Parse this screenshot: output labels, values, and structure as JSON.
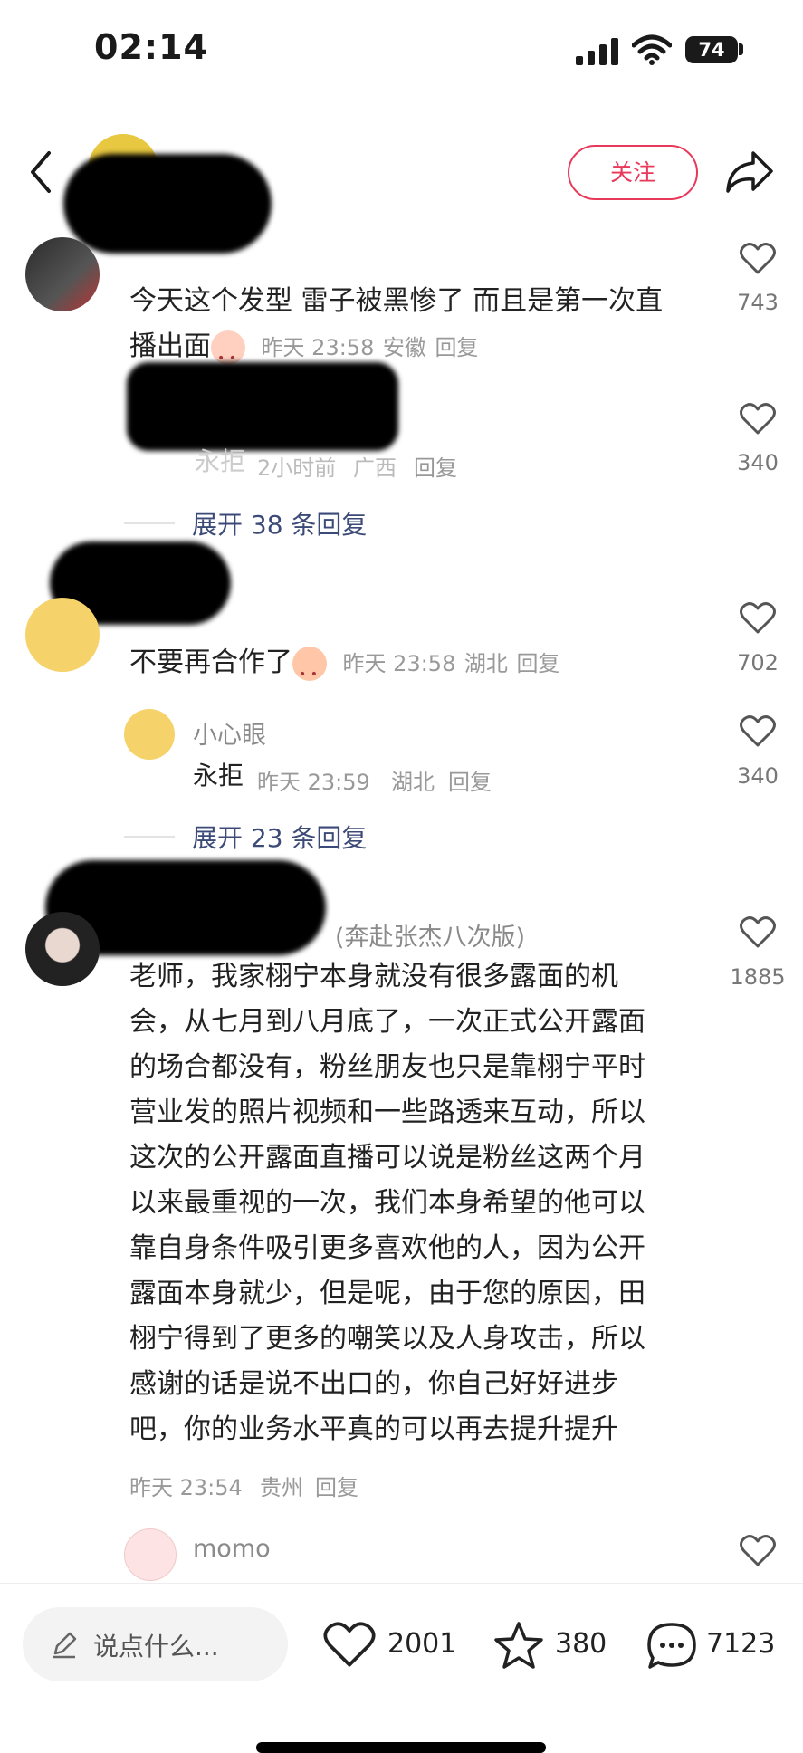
{
  "status_bar": {
    "time": "02:14",
    "battery": "74"
  },
  "header": {
    "follow_label": "关注"
  },
  "comments": [
    {
      "name": "",
      "text": "今天这个发型 雷子被黑惨了 而且是第一次直播出面",
      "text_line1": "今天这个发型 雷子被黑惨了 而且是第一次直",
      "text_line2": "播出面",
      "meta_time": "昨天 23:58",
      "meta_location": "安徽",
      "meta_reply": "回复",
      "likes": "743",
      "replies": [
        {
          "name": "",
          "text": "永拒",
          "meta_time": "2小时前",
          "meta_location": "广西",
          "meta_reply": "回复",
          "likes": "340"
        }
      ],
      "expand_label": "展开 38 条回复"
    },
    {
      "name": "",
      "text": "不要再合作了",
      "meta_time": "昨天 23:58",
      "meta_location": "湖北",
      "meta_reply": "回复",
      "likes": "702",
      "replies": [
        {
          "name": "小心眼",
          "text": "永拒",
          "meta_time": "昨天 23:59",
          "meta_location": "湖北",
          "meta_reply": "回复",
          "likes": "340"
        }
      ],
      "expand_label": "展开 23 条回复"
    },
    {
      "name_suffix": "(奔赴张杰八次版)",
      "lines": [
        "老师，我家栩宁本身就没有很多露面的机",
        "会，从七月到八月底了，一次正式公开露面",
        "的场合都没有，粉丝朋友也只是靠栩宁平时",
        "营业发的照片视频和一些路透来互动，所以",
        "这次的公开露面直播可以说是粉丝这两个月",
        "以来最重视的一次，我们本身希望的他可以",
        "靠自身条件吸引更多喜欢他的人，因为公开",
        "露面本身就少，但是呢，由于您的原因，田",
        "栩宁得到了更多的嘲笑以及人身攻击，所以",
        "感谢的话是说不出口的，你自己好好进步",
        "吧，你的业务水平真的可以再去提升提升"
      ],
      "meta_time": "昨天 23:54",
      "meta_location": "贵州",
      "meta_reply": "回复",
      "likes": "1885",
      "reply_name": "momo"
    }
  ],
  "bottom_bar": {
    "input_placeholder": "说点什么...",
    "likes": "2001",
    "favorites": "380",
    "comments": "7123"
  }
}
